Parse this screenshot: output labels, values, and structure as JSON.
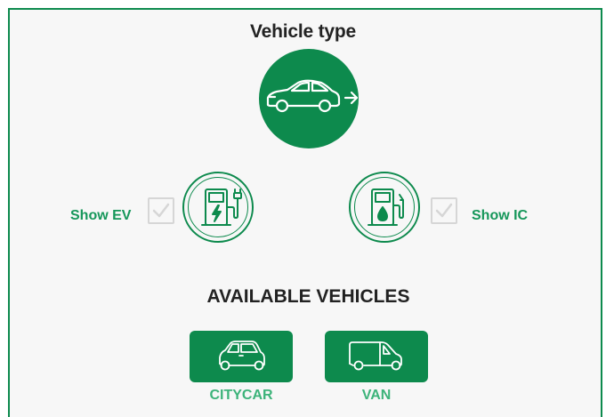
{
  "header": {
    "title": "Vehicle type"
  },
  "vehicle_type_icon": "car-arrow-icon",
  "filters": {
    "ev": {
      "label": "Show EV",
      "checked": true,
      "icon": "ev-charger-icon"
    },
    "ic": {
      "label": "Show IC",
      "checked": true,
      "icon": "fuel-pump-icon"
    }
  },
  "available": {
    "title": "AVAILABLE VEHICLES",
    "items": [
      {
        "label": "CITYCAR",
        "icon": "citycar-icon"
      },
      {
        "label": "VAN",
        "icon": "van-icon"
      }
    ]
  },
  "colors": {
    "accent": "#0d8a4d",
    "label": "#16975a",
    "checkbox": "#d6d6d6"
  }
}
